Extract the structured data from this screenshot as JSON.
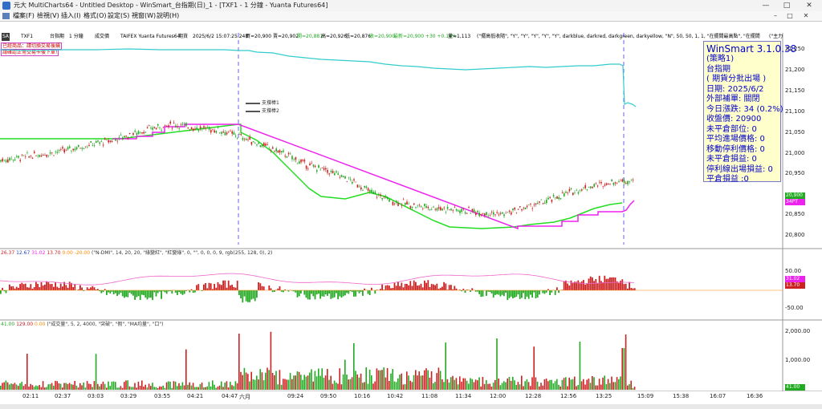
{
  "window": {
    "title": "元大 MultiCharts64 - Untitled Desktop - WinSmart_台指期(日)_1 - [TXF1 - 1 分鐘 - Yuanta Futures64]",
    "minimize": "—",
    "maximize": "□",
    "close": "✕"
  },
  "menu": {
    "items": [
      "檔案(F)",
      "檢視(V)",
      "插入(I)",
      "格式(O)",
      "設定(S)",
      "視窗(W)",
      "說明(H)"
    ],
    "mdi": [
      "–",
      "□",
      "✕"
    ]
  },
  "infobar": {
    "badge": "SA",
    "symbol": "TXF1",
    "name": "台指期",
    "interval": "1 分鐘",
    "volume_label": "成交價",
    "feed": "TAIFEX Yuanta Futures64",
    "session": "期貨",
    "datetime": "2025/6/2 15:07:25.248",
    "quote_bid": "買=20,900",
    "quote_ask": "賣=20,902",
    "quote_open": "開=20,881",
    "quote_high": "高=20,926",
    "quote_low": "低=20,876",
    "quote_close": "收=20,900",
    "quote_last": "最新=20,900 +30 +0.14%",
    "quote_vol": "量=1,113",
    "study_params": "(\"擺高低收隨\", \"Y\", \"Y\", \"Y\", \"Y\", \"Y\", darkblue, darkred, darkgreen, darkyellow, \"N\", 50, 50, 1, 1, \"在擺間最高點\", \"在擺間",
    "right_cut": "(\"主力"
  },
  "side_labels": {
    "top_red": "已經商品：請切換交易後續",
    "second_red": "請確認正常交易卡後下單!"
  },
  "legend": {
    "line1": "支撐棒1",
    "line2": "支撐棒2"
  },
  "panel": {
    "title": "WinSmart 3.1.0.38",
    "strategy": "(策略1)",
    "product": "台指期",
    "mode": "( 期貨分批出場 )",
    "date": "日期: 2025/6/2",
    "external": "外部補單: 關閉",
    "change": "今日漲跌: 34 (0.2%)",
    "close": "收盤價: 20900",
    "open_pos": "未平倉部位: 0",
    "avg_entry": "平均進場價格: 0",
    "trail_stop": "移動停利價格: 0",
    "unrealized": "未平倉損益: 0",
    "stop_exit": "停利線出場損益: 0",
    "realized": "平倉損益 :0"
  },
  "price_axis": {
    "ticks": [
      "21,250",
      "21,200",
      "21,150",
      "21,100",
      "21,050",
      "21,000",
      "20,950",
      "20,900",
      "20,850",
      "20,800"
    ],
    "last_tag": "20,900",
    "sub_tag": "34PT"
  },
  "indicator1": {
    "vals": [
      "26.37",
      "12.67",
      "31.02",
      "13.70",
      "0.00",
      "-20.00"
    ],
    "params": "(\"N-DMI\", 14, 20, 20, \"綠變紅\", \"紅變綠\", 0, \"\", 0, 0, 0, 9, rgb(255, 128, 0), 2)",
    "ticks": [
      "50.00",
      "0.00",
      "-50.00"
    ],
    "tag_pink": "31.02",
    "tag_red": "13.70"
  },
  "indicator2": {
    "vals": [
      "41.00",
      "129.00",
      "0.00"
    ],
    "params": "(\"成交量\", 5, 2, 4000, \"突破\", \"假\", \"MA均量\", \"口\")",
    "ticks": [
      "2,000.00",
      "1,000.00"
    ],
    "tag": "41.00"
  },
  "time_axis": [
    "02:11",
    "02:37",
    "03:03",
    "03:29",
    "03:55",
    "04:21",
    "04:47",
    "六月",
    "09:24",
    "09:50",
    "10:16",
    "10:42",
    "11:08",
    "11:34",
    "12:00",
    "12:28",
    "12:56",
    "13:25",
    "15:09",
    "15:38",
    "16:07",
    "16:36"
  ],
  "colors": {
    "up": "#cc2222",
    "down": "#22aa22",
    "cyan": "#33cccc",
    "green_line": "#22dd22",
    "magenta_line": "#ee22ee",
    "panel_text": "#0000cc"
  },
  "chart_data": {
    "type": "line",
    "title": "",
    "xlabel": "",
    "ylabel": "",
    "ylim": [
      20780,
      21270
    ],
    "series": [
      {
        "name": "",
        "values": [
          20975,
          20982,
          20990,
          20998,
          21010,
          21020,
          21035,
          21050,
          21058,
          21050,
          21045,
          21030,
          21010,
          20990,
          20965,
          20950,
          20930,
          20900,
          20880,
          20870,
          20865,
          20860,
          20855,
          20850,
          20865,
          20880,
          20900,
          20915,
          20925,
          20930
        ]
      }
    ]
  }
}
